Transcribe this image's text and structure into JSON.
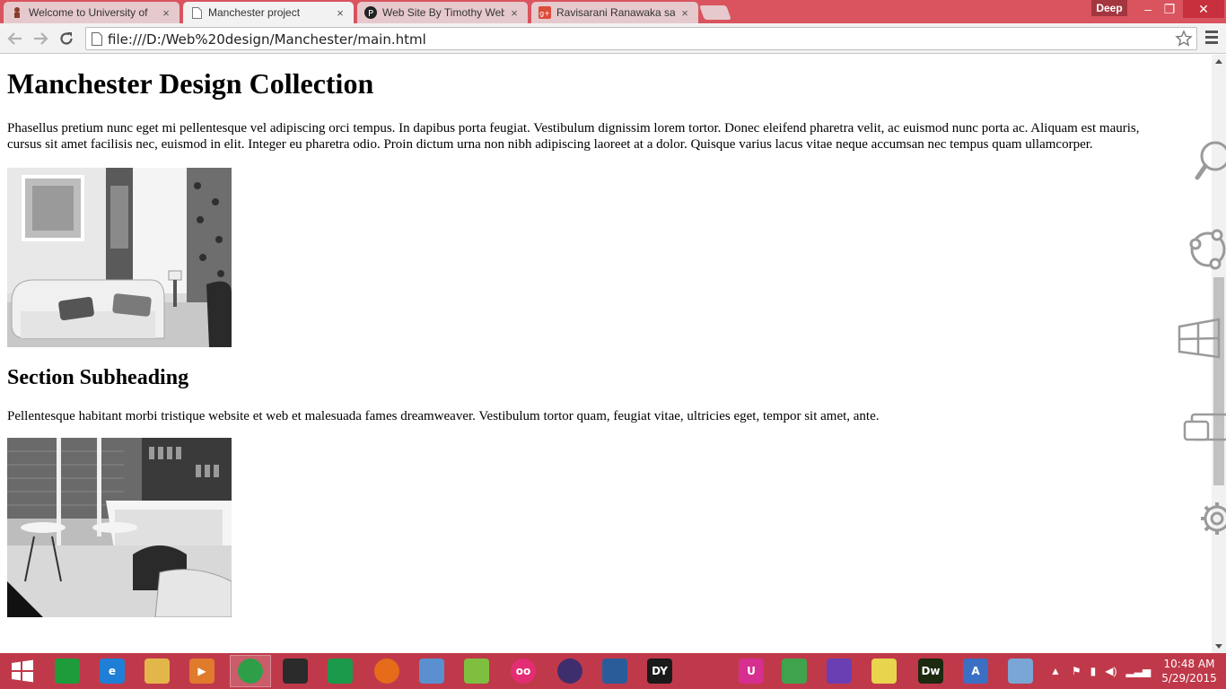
{
  "browser": {
    "tabs": [
      {
        "title": "Welcome to University of",
        "icon": "university-favicon",
        "active": false
      },
      {
        "title": "Manchester project",
        "icon": "page-icon",
        "active": true
      },
      {
        "title": "Web Site By Timothy Web",
        "icon": "pinterest-p-icon",
        "active": false
      },
      {
        "title": "Ravisarani Ranawaka says",
        "icon": "google-plus-icon",
        "active": false
      }
    ],
    "user_badge": "Deep",
    "url": "file:///D:/Web%20design/Manchester/main.html",
    "close_glyph": "×",
    "window_buttons": {
      "minimize": "–",
      "maximize": "❐",
      "close": "✕"
    }
  },
  "page": {
    "heading": "Manchester Design Collection",
    "intro": "Phasellus pretium nunc eget mi pellentesque vel adipiscing orci tempus. In dapibus porta feugiat. Vestibulum dignissim lorem tortor. Donec eleifend pharetra velit, ac euismod nunc porta ac. Aliquam est mauris, cursus sit amet facilisis nec, euismod in elit. Integer eu pharetra odio. Proin dictum urna non nibh adipiscing laoreet at a dolor. Quisque varius lacus vitae neque accumsan nec tempus quam ullamcorper.",
    "image1": "living-room-photo",
    "subheading": "Section Subheading",
    "section_text": "Pellentesque habitant morbi tristique website et web et malesuada fames dreamweaver. Vestibulum tortor quam, feugiat vitae, ultricies eget, tempor sit amet, ante.",
    "image2": "cafe-interior-photo"
  },
  "charms": [
    "search-charm-icon",
    "share-charm-icon",
    "start-charm-icon",
    "devices-charm-icon",
    "settings-charm-icon"
  ],
  "taskbar": {
    "items": [
      {
        "name": "store-icon",
        "label": "",
        "color": "#1e9b3a"
      },
      {
        "name": "internet-explorer-icon",
        "label": "e",
        "color": "#1f7fd6"
      },
      {
        "name": "file-explorer-icon",
        "label": "",
        "color": "#e3b64a"
      },
      {
        "name": "media-player-icon",
        "label": "▶",
        "color": "#e07a2c"
      },
      {
        "name": "chrome-icon",
        "label": "",
        "color": "#2f9e49"
      },
      {
        "name": "nvidia-icon",
        "label": "",
        "color": "#2b2b2b"
      },
      {
        "name": "spiral-app-icon",
        "label": "",
        "color": "#1a9a4a"
      },
      {
        "name": "firefox-icon",
        "label": "",
        "color": "#e66b1b"
      },
      {
        "name": "virtualbox-cube-icon",
        "label": "",
        "color": "#5a8fd0"
      },
      {
        "name": "notepad-plus-plus-icon",
        "label": "",
        "color": "#7fbf3f"
      },
      {
        "name": "flickr-icon",
        "label": "oo",
        "color": "#e32d74"
      },
      {
        "name": "eclipse-icon",
        "label": "",
        "color": "#3e2e6e"
      },
      {
        "name": "virtualbox-icon",
        "label": "",
        "color": "#2a5c9a"
      },
      {
        "name": "dyrazor-icon",
        "label": "DY",
        "color": "#1a1a1a"
      },
      {
        "name": "remote-display-icon",
        "label": "",
        "color": "#c0394a"
      },
      {
        "name": "uplay-icon",
        "label": "U",
        "color": "#d62f8f"
      },
      {
        "name": "android-studio-icon",
        "label": "",
        "color": "#3fa34d"
      },
      {
        "name": "visual-studio-icon",
        "label": "",
        "color": "#6a3fb3"
      },
      {
        "name": "sticky-notes-icon",
        "label": "",
        "color": "#e8d44d"
      },
      {
        "name": "dreamweaver-icon",
        "label": "Dw",
        "color": "#1c2a10"
      },
      {
        "name": "wordpad-icon",
        "label": "A",
        "color": "#3a6fc4"
      },
      {
        "name": "paint-icon",
        "label": "",
        "color": "#7aa6d6"
      }
    ],
    "time": "10:48 AM",
    "date": "5/29/2015"
  }
}
